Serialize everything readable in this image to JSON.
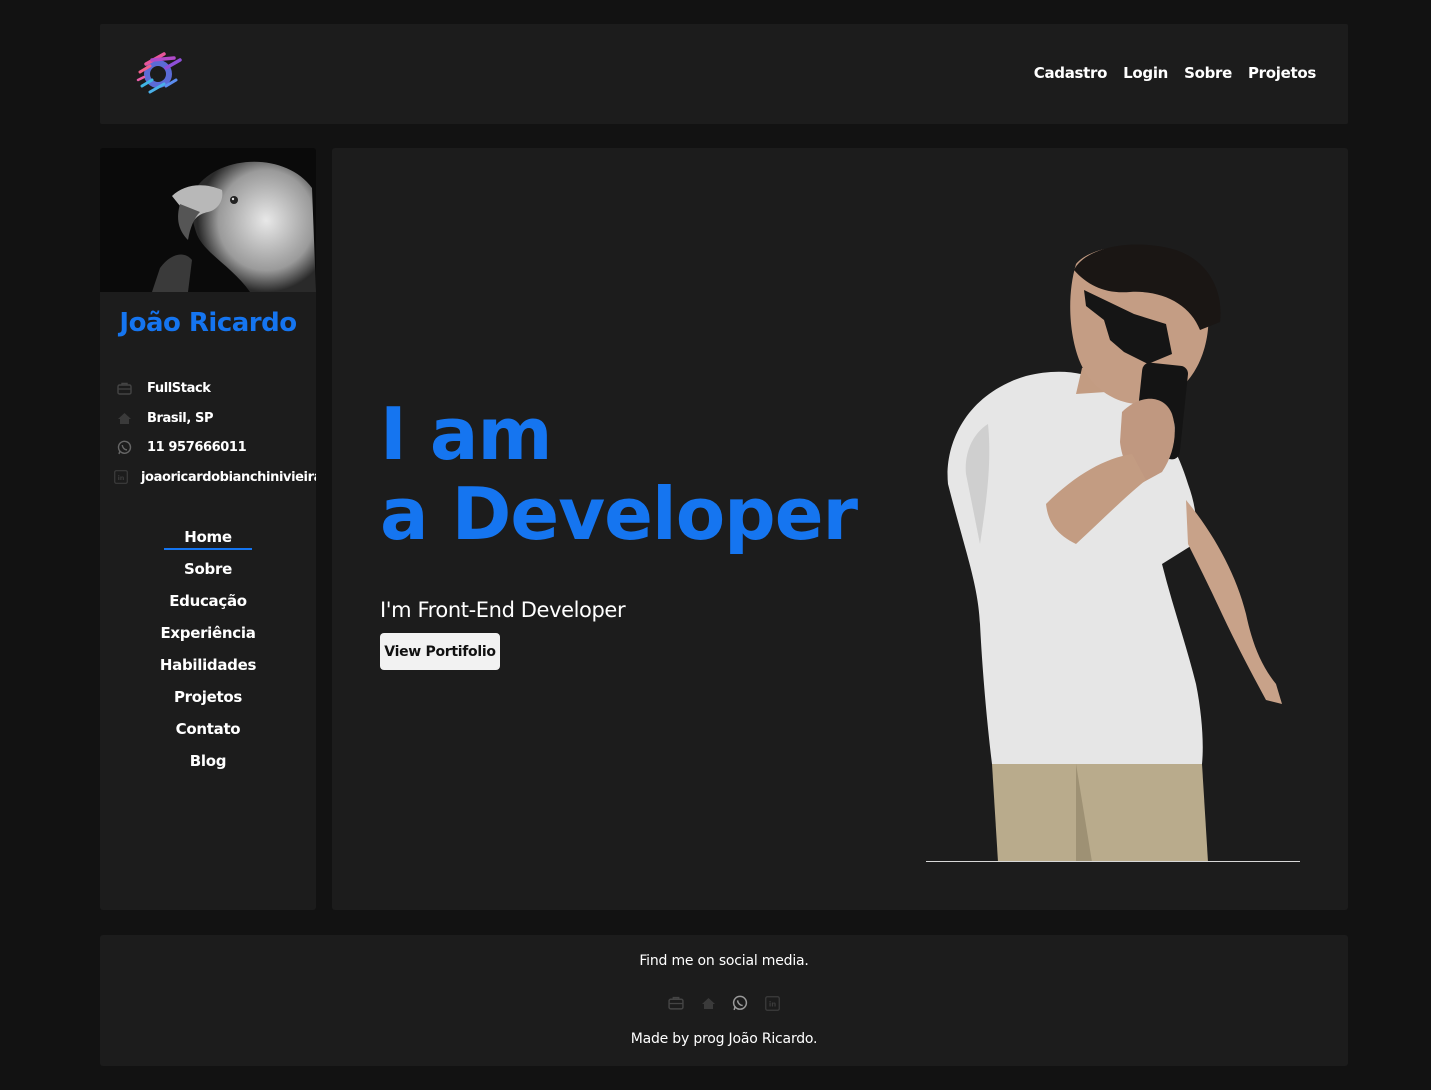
{
  "colors": {
    "accent": "#1575f0",
    "panel": "#1c1c1c",
    "background": "#121212"
  },
  "header": {
    "logo_icon": "colorful-speed-circle-logo",
    "nav": [
      "Cadastro",
      "Login",
      "Sobre",
      "Projetos"
    ]
  },
  "sidebar": {
    "name": "João Ricardo",
    "info": [
      {
        "icon": "briefcase-icon",
        "text": "FullStack"
      },
      {
        "icon": "home-icon",
        "text": "Brasil, SP"
      },
      {
        "icon": "whatsapp-icon",
        "text": "11 957666011"
      },
      {
        "icon": "linkedin-icon",
        "text": "joaoricardobianchinivieira"
      }
    ],
    "nav": [
      "Home",
      "Sobre",
      "Educação",
      "Experiência",
      "Habilidades",
      "Projetos",
      "Contato",
      "Blog"
    ],
    "active": "Home"
  },
  "hero": {
    "title_line1": "I am",
    "title_line2": "a Developer",
    "subtitle": "I'm Front-End Developer",
    "cta_label": "View Portifolio"
  },
  "footer": {
    "title": "Find me on social media.",
    "icons": [
      "briefcase-icon",
      "home-icon",
      "whatsapp-icon",
      "linkedin-icon"
    ],
    "credit": "Made by prog João Ricardo."
  }
}
